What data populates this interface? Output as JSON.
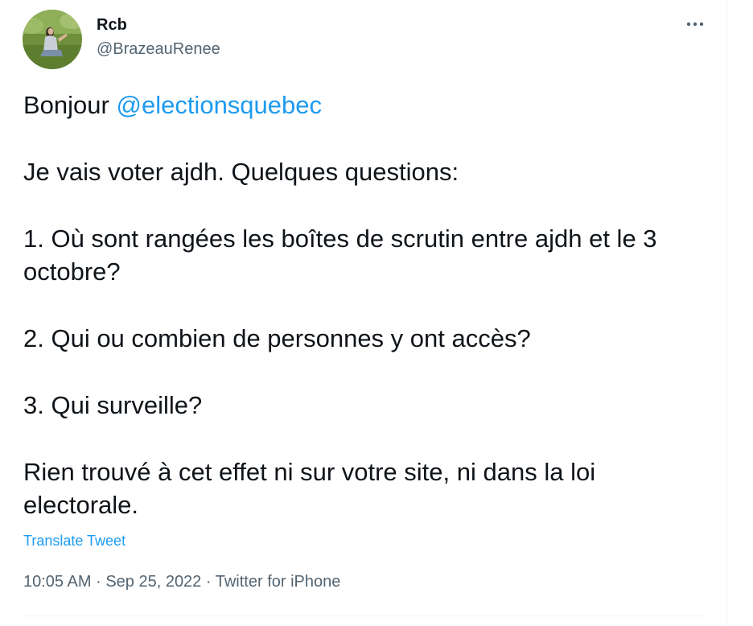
{
  "author": {
    "display_name": "Rcb",
    "handle": "@BrazeauRenee"
  },
  "tweet": {
    "greeting": "Bonjour",
    "mention": "@electionsquebec",
    "paragraphs": [
      "Je vais voter ajdh. Quelques questions:",
      "1. Où sont rangées les boîtes de scrutin entre ajdh et le 3 octobre?",
      "2. Qui ou combien de personnes y ont accès?",
      "3. Qui surveille?",
      "Rien trouvé à cet effet ni sur votre site, ni dans la loi electorale."
    ],
    "translate_label": "Translate Tweet",
    "time": "10:05 AM",
    "date": "Sep 25, 2022",
    "source": "Twitter for iPhone",
    "separator": "·"
  },
  "icons": {
    "more": "more-horizontal-icon"
  },
  "colors": {
    "link": "#1d9bf0",
    "secondary_text": "#536471",
    "primary_text": "#0f1419"
  }
}
